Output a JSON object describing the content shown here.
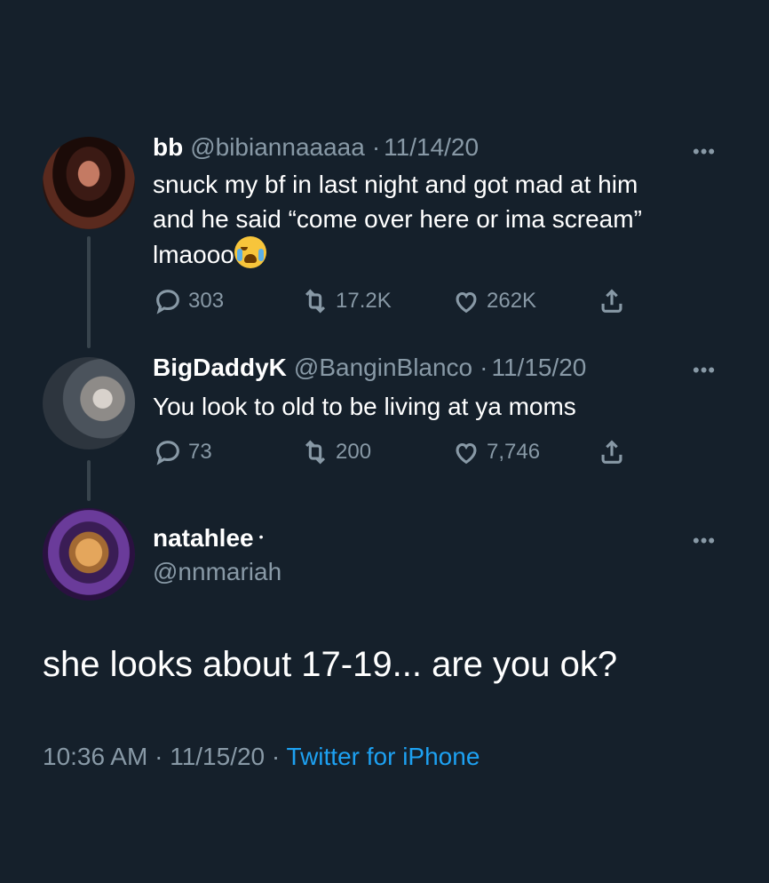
{
  "tweets": [
    {
      "display_name": "bb",
      "handle": "@bibiannaaaaa",
      "separator": "·",
      "date": "11/14/20",
      "text_lines": [
        "snuck my bf in last night and got mad at him",
        "and he said “come over here or ima scream”",
        "lmaooo"
      ],
      "emoji": "loudly-crying-face",
      "replies": "303",
      "retweets": "17.2K",
      "likes": "262K"
    },
    {
      "display_name": "BigDaddyK",
      "handle": "@BanginBlanco",
      "separator": "·",
      "date": "11/15/20",
      "text": "You look to old to be living at ya moms",
      "replies": "73",
      "retweets": "200",
      "likes": "7,746"
    }
  ],
  "main": {
    "display_name": "natahlee",
    "name_badge": "•",
    "handle": "@nnmariah",
    "text": "she looks about 17-19... are you ok?",
    "time": "10:36 AM",
    "separator": "·",
    "date": "11/15/20",
    "source": "Twitter for iPhone"
  },
  "more_label": "•••",
  "colors": {
    "background": "#15202b",
    "muted": "#8899a6",
    "link": "#1da1f2",
    "thread_line": "#38444d"
  },
  "icons": [
    "reply-icon",
    "retweet-icon",
    "like-icon",
    "share-icon",
    "more-icon"
  ]
}
